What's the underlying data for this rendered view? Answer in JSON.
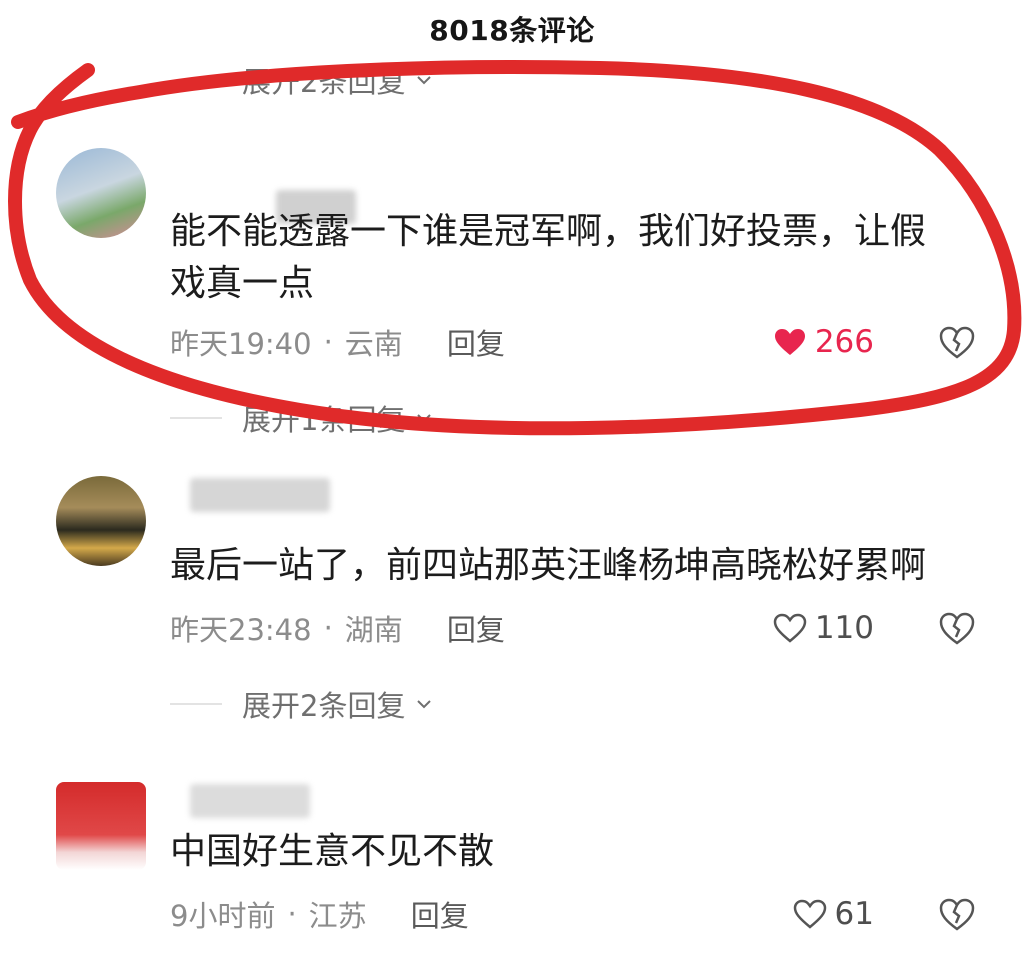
{
  "header": {
    "title": "8018条评论"
  },
  "top_expand": {
    "label": "展开2条回复"
  },
  "comments": [
    {
      "text_line1": "能不能透露一下谁是冠军啊，我们好投票，让假",
      "text_line2": "戏真一点",
      "time": "昨天19:40",
      "location": "云南",
      "reply_label": "回复",
      "likes": "266",
      "liked": true,
      "expand_label": "展开1条回复"
    },
    {
      "text_line1": "最后一站了，前四站那英汪峰杨坤高晓松好累啊",
      "time": "昨天23:48",
      "location": "湖南",
      "reply_label": "回复",
      "likes": "110",
      "liked": false,
      "expand_label": "展开2条回复"
    },
    {
      "text_line1": "中国好生意不见不散",
      "time": "9小时前",
      "location": "江苏",
      "reply_label": "回复",
      "likes": "61",
      "liked": false
    }
  ],
  "colors": {
    "like_active": "#e8254e",
    "annotation_circle": "#e02a2a"
  },
  "icons": [
    "chevron-down-icon",
    "heart-icon",
    "dislike-broken-heart-icon"
  ]
}
